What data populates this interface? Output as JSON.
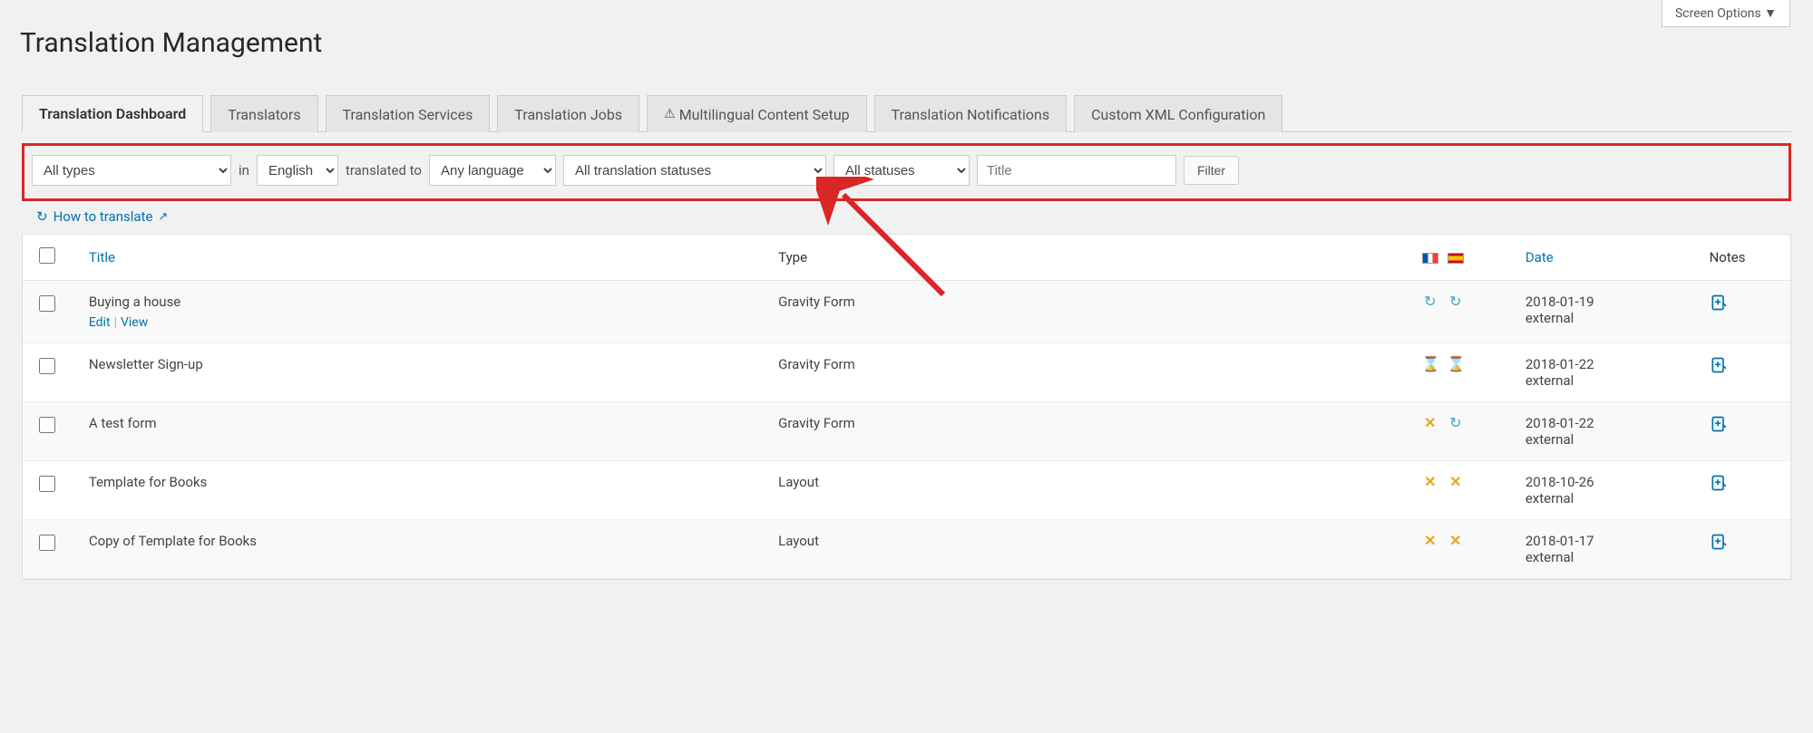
{
  "screenOptions": "Screen Options ▼",
  "pageTitle": "Translation Management",
  "tabs": [
    {
      "label": "Translation Dashboard",
      "active": true,
      "name": "tab-translation-dashboard"
    },
    {
      "label": "Translators",
      "active": false,
      "name": "tab-translators"
    },
    {
      "label": "Translation Services",
      "active": false,
      "name": "tab-translation-services"
    },
    {
      "label": "Translation Jobs",
      "active": false,
      "name": "tab-translation-jobs"
    },
    {
      "label": "Multilingual Content Setup",
      "active": false,
      "warning": true,
      "name": "tab-multilingual-setup"
    },
    {
      "label": "Translation Notifications",
      "active": false,
      "name": "tab-translation-notifications"
    },
    {
      "label": "Custom XML Configuration",
      "active": false,
      "name": "tab-custom-xml"
    }
  ],
  "filters": {
    "types": "All types",
    "labelIn": "in",
    "fromLang": "English",
    "labelTranslatedTo": "translated to",
    "toLang": "Any language",
    "transStatus": "All translation statuses",
    "status": "All statuses",
    "titlePlaceholder": "Title",
    "filterBtn": "Filter"
  },
  "howTo": {
    "text": "How to translate"
  },
  "columns": {
    "title": "Title",
    "type": "Type",
    "date": "Date",
    "notes": "Notes"
  },
  "rows": [
    {
      "title": "Buying a house",
      "type": "Gravity Form",
      "date": "2018-01-19",
      "dateSub": "external",
      "status1": "refresh",
      "status2": "refresh",
      "actions": true,
      "edit": "Edit",
      "view": "View"
    },
    {
      "title": "Newsletter Sign-up",
      "type": "Gravity Form",
      "date": "2018-01-22",
      "dateSub": "external",
      "status1": "hourglass",
      "status2": "hourglass"
    },
    {
      "title": "A test form",
      "type": "Gravity Form",
      "date": "2018-01-22",
      "dateSub": "external",
      "status1": "x",
      "status2": "refresh"
    },
    {
      "title": "Template for Books",
      "type": "Layout",
      "date": "2018-10-26",
      "dateSub": "external",
      "status1": "x",
      "status2": "x"
    },
    {
      "title": "Copy of Template for Books",
      "type": "Layout",
      "date": "2018-01-17",
      "dateSub": "external",
      "status1": "x",
      "status2": "x"
    }
  ]
}
